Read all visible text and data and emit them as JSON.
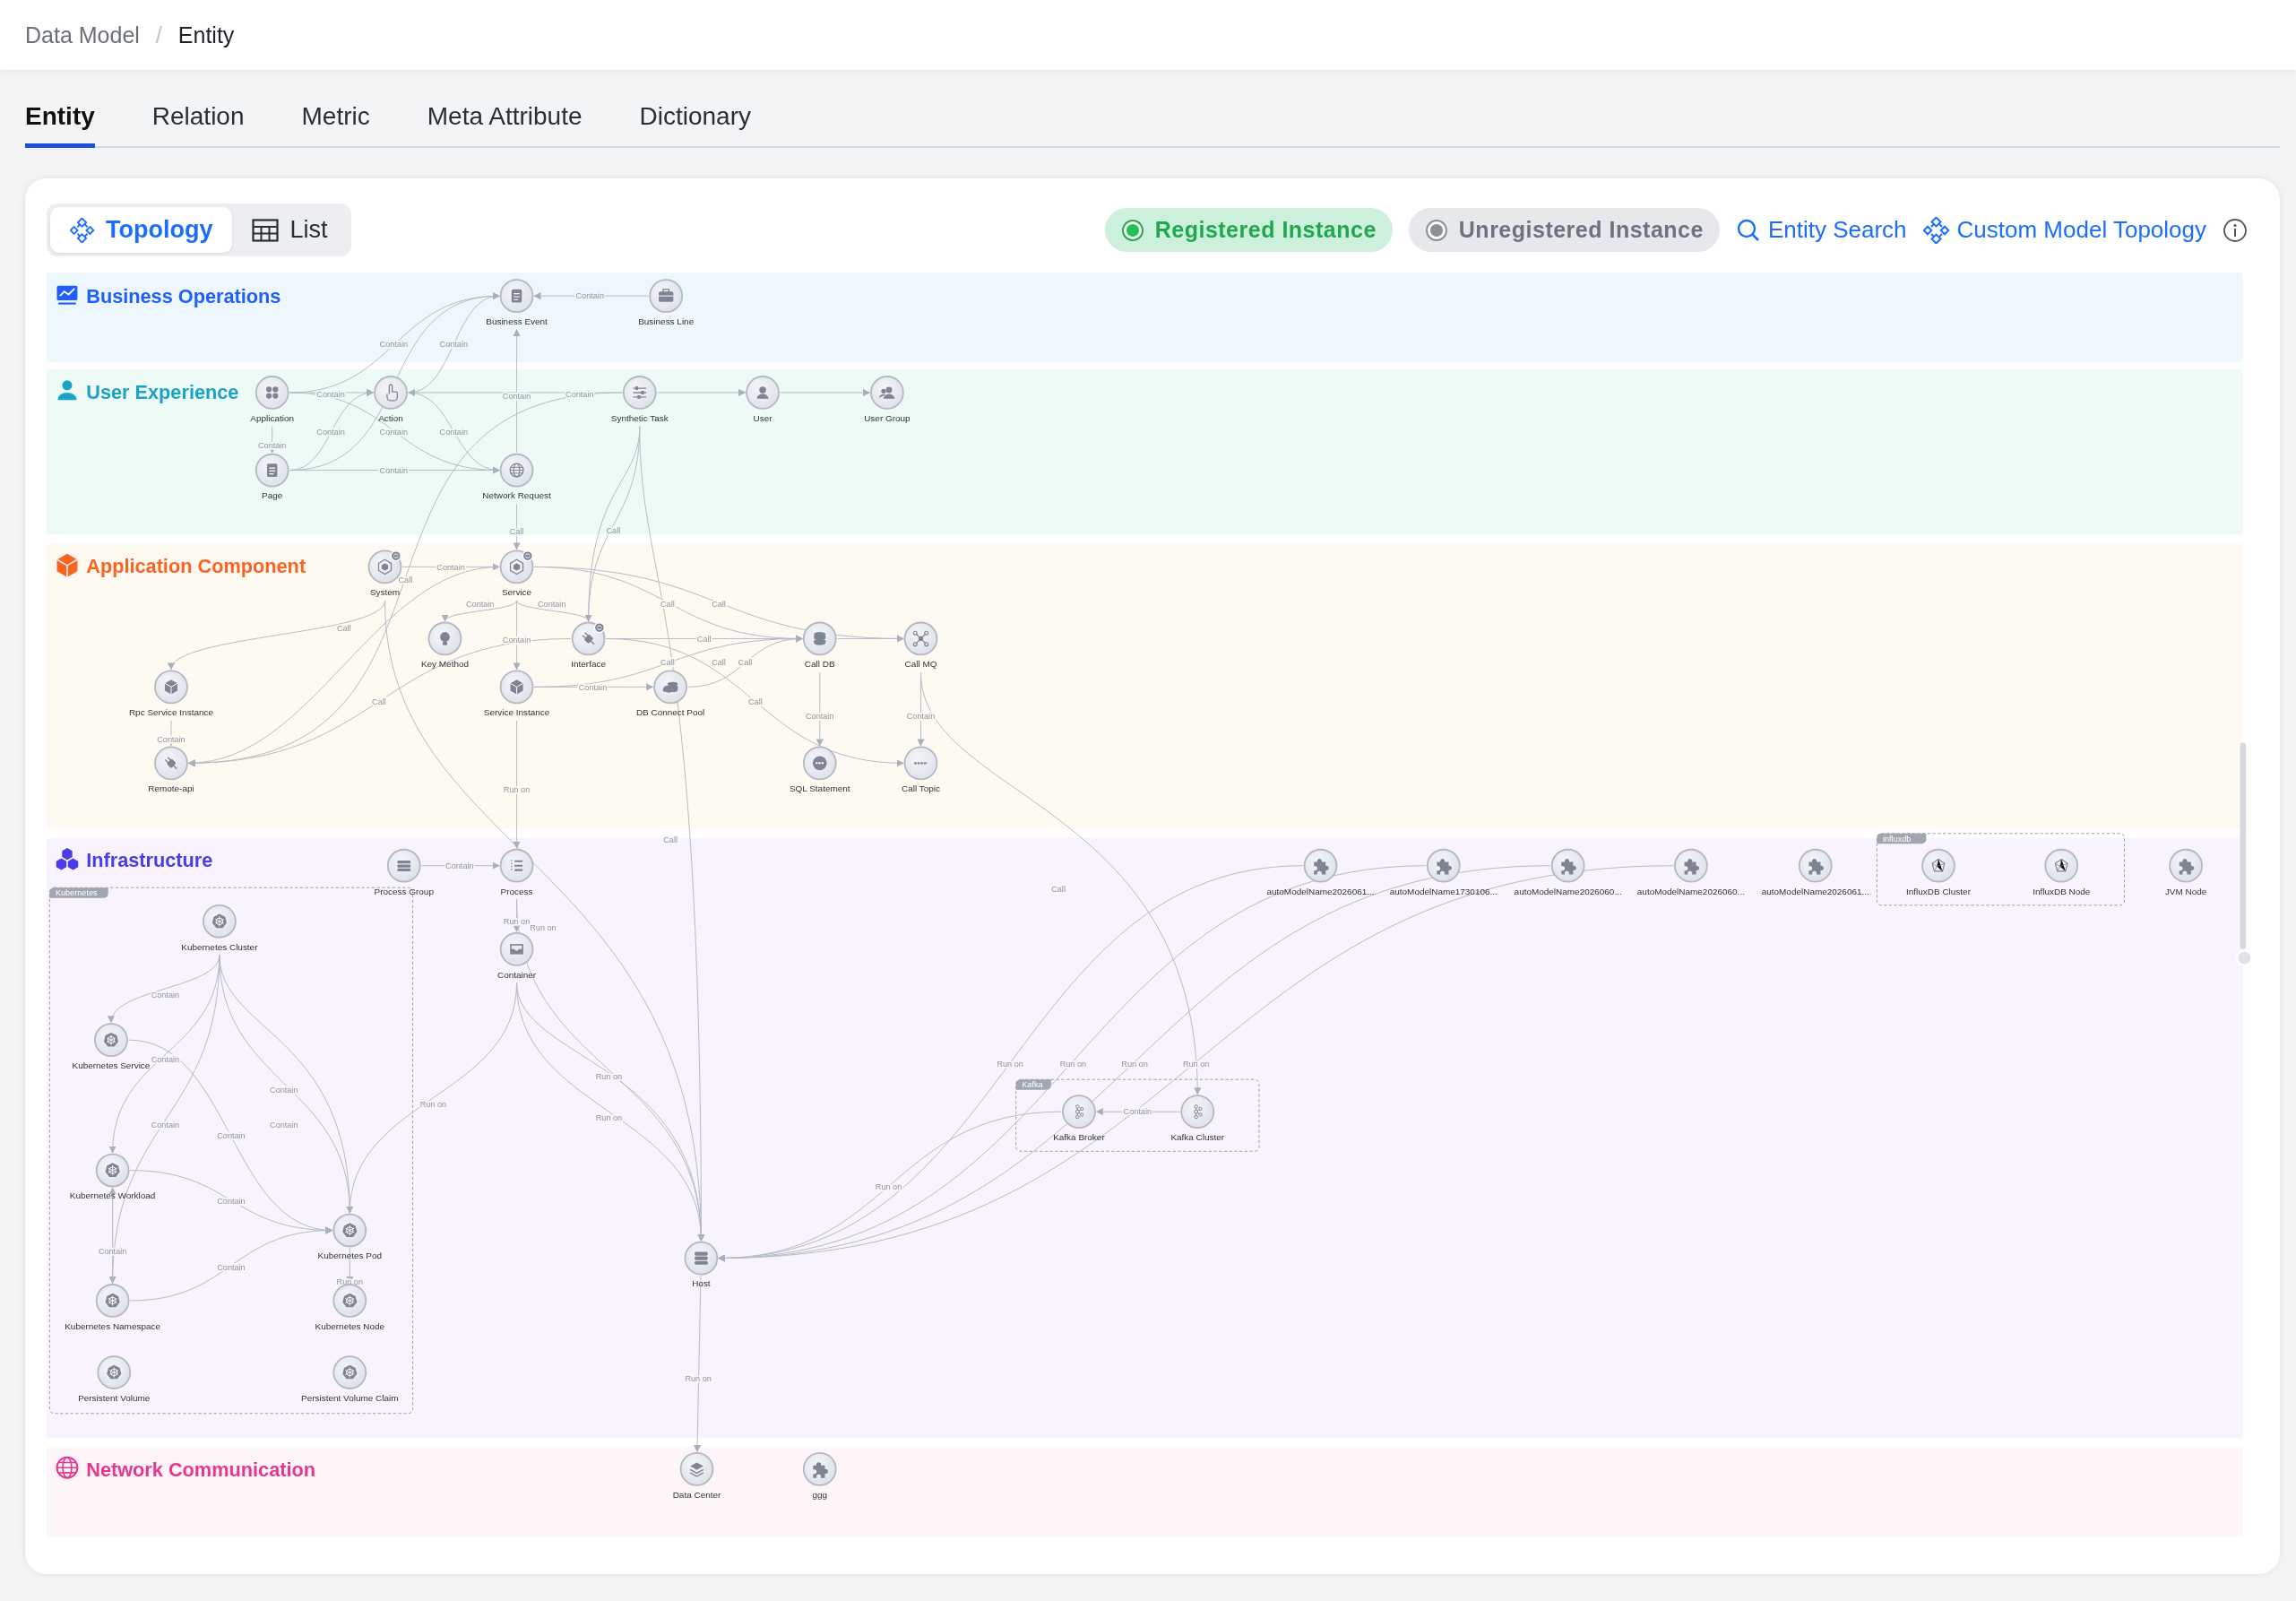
{
  "breadcrumb": {
    "items": [
      "Data Model",
      "Entity"
    ],
    "separator": "/"
  },
  "tabs": [
    {
      "label": "Entity",
      "selected": true
    },
    {
      "label": "Relation",
      "selected": false
    },
    {
      "label": "Metric",
      "selected": false
    },
    {
      "label": "Meta Attribute",
      "selected": false
    },
    {
      "label": "Dictionary",
      "selected": false
    }
  ],
  "toolbar": {
    "views": [
      {
        "label": "Topology",
        "selected": true
      },
      {
        "label": "List",
        "selected": false
      }
    ],
    "filters": [
      {
        "label": "Registered Instance",
        "kind": "registered"
      },
      {
        "label": "Unregistered Instance",
        "kind": "unregistered"
      }
    ],
    "links": [
      "Entity Search",
      "Custom Model Topology"
    ]
  },
  "diagram": {
    "lanes": [
      {
        "title": "Business Operations",
        "nodes": [
          {
            "label": "Business Event"
          },
          {
            "label": "Business Line"
          }
        ]
      },
      {
        "title": "User Experience",
        "nodes": [
          {
            "label": "Application"
          },
          {
            "label": "Action"
          },
          {
            "label": "Synthetic Task"
          },
          {
            "label": "User"
          },
          {
            "label": "User Group"
          },
          {
            "label": "Page"
          },
          {
            "label": "Network Request"
          }
        ]
      },
      {
        "title": "Application Component",
        "nodes": [
          {
            "label": "System"
          },
          {
            "label": "Service"
          },
          {
            "label": "Key Method"
          },
          {
            "label": "Interface"
          },
          {
            "label": "Call DB"
          },
          {
            "label": "Call MQ"
          },
          {
            "label": "Rpc Service Instance"
          },
          {
            "label": "Service Instance"
          },
          {
            "label": "DB Connect Pool"
          },
          {
            "label": "Remote-api"
          },
          {
            "label": "SQL Statement"
          },
          {
            "label": "Call Topic"
          }
        ]
      },
      {
        "title": "Infrastructure",
        "nodes": [
          {
            "label": "Process Group"
          },
          {
            "label": "Process"
          },
          {
            "label": "autoModelName2026061..."
          },
          {
            "label": "autoModelName1730106..."
          },
          {
            "label": "autoModelName2026060..."
          },
          {
            "label": "autoModelName2026060..."
          },
          {
            "label": "autoModelName2026061..."
          },
          {
            "label": "InfluxDB Cluster"
          },
          {
            "label": "InfluxDB Node"
          },
          {
            "label": "JVM Node"
          },
          {
            "label": "Kubernetes Cluster"
          },
          {
            "label": "Container"
          },
          {
            "label": "Kubernetes Service"
          },
          {
            "label": "Kafka Broker"
          },
          {
            "label": "Kafka Cluster"
          },
          {
            "label": "Kubernetes Workload"
          },
          {
            "label": "Kubernetes Pod"
          },
          {
            "label": "Host"
          },
          {
            "label": "Kubernetes Namespace"
          },
          {
            "label": "Kubernetes Node"
          },
          {
            "label": "Persistent Volume"
          },
          {
            "label": "Persistent Volume Claim"
          }
        ]
      },
      {
        "title": "Network Communication",
        "nodes": [
          {
            "label": "Data Center"
          },
          {
            "label": "ggg"
          }
        ]
      }
    ],
    "groups": [
      {
        "tag": "Kubernetes"
      },
      {
        "tag": "Kafka"
      },
      {
        "tag": "influxdb"
      }
    ],
    "edge_labels": [
      "Contain",
      "Contain",
      "Contain",
      "Contain",
      "Contain",
      "Contain",
      "Contain",
      "Contain",
      "Contain",
      "Contain",
      "Contain",
      "Call",
      "Call",
      "Contain",
      "Call",
      "Contain",
      "Contain",
      "Call",
      "Call",
      "Call",
      "Contain",
      "Call",
      "Call",
      "Call",
      "Call",
      "Contain",
      "Call",
      "Call",
      "Contain",
      "Contain",
      "Contain",
      "Run on",
      "Call",
      "Contain",
      "Call",
      "Run on",
      "Run on",
      "Contain",
      "Contain",
      "Run on",
      "Run on",
      "Run on",
      "Run on",
      "Run on",
      "Contain",
      "Run on",
      "Contain",
      "Run on",
      "Contain",
      "Contain",
      "Contain",
      "Run on",
      "Contain",
      "Contain",
      "Contain",
      "Run on",
      "Run on"
    ]
  }
}
